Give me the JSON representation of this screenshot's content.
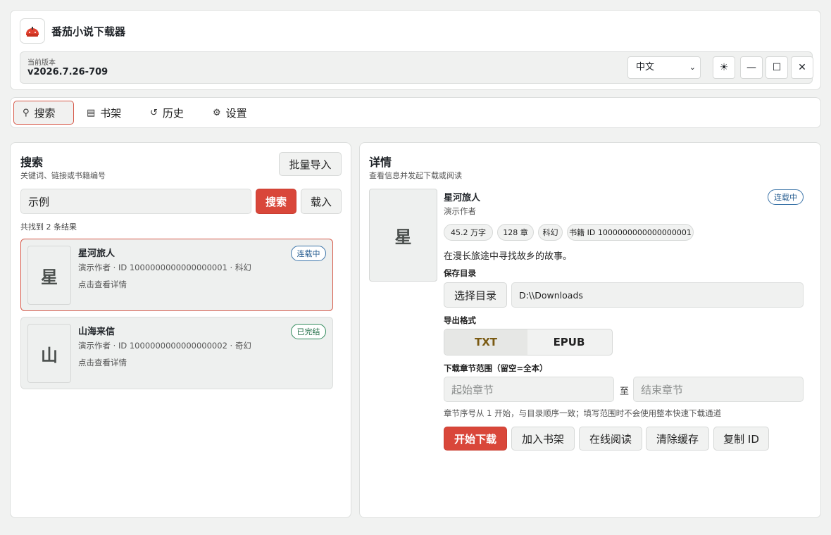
{
  "app": {
    "title": "番茄小说下载器",
    "logo_icon": "tomato-icon"
  },
  "version": {
    "label": "当前版本",
    "value": "v2026.7.26-709"
  },
  "window": {
    "language": "中文",
    "theme_icon": "sun-icon",
    "minimize_icon": "minimize-icon",
    "maximize_icon": "maximize-icon",
    "close_icon": "close-icon"
  },
  "nav": {
    "tabs": [
      {
        "label": "搜索",
        "icon": "search-icon",
        "active": true
      },
      {
        "label": "书架",
        "icon": "bookshelf-icon"
      },
      {
        "label": "历史",
        "icon": "history-icon"
      },
      {
        "label": "设置",
        "icon": "gear-icon"
      }
    ]
  },
  "search": {
    "title": "搜索",
    "subtitle": "关键词、链接或书籍编号",
    "batch_import": "批量导入",
    "query": "示例",
    "search_button": "搜索",
    "load_button": "载入",
    "result_count": "共找到 2 条结果",
    "results": [
      {
        "cover": "星",
        "title": "星河旅人",
        "meta": "演示作者 · ID 1000000000000000001 · 科幻",
        "hint": "点击查看详情",
        "status": "连载中"
      },
      {
        "cover": "山",
        "title": "山海来信",
        "meta": "演示作者 · ID 1000000000000000002 · 奇幻",
        "hint": "点击查看详情",
        "status": "已完结"
      }
    ]
  },
  "detail": {
    "title": "详情",
    "subtitle": "查看信息并发起下载或阅读",
    "cover": "星",
    "book_title": "星河旅人",
    "author": "演示作者",
    "status": "连载中",
    "chips": [
      "45.2 万字",
      "128 章",
      "科幻",
      "书籍 ID 1000000000000000001"
    ],
    "description": "在漫长旅途中寻找故乡的故事。",
    "save_dir_label": "保存目录",
    "choose_dir_button": "选择目录",
    "save_dir_value": "D:\\\\Downloads",
    "format_label": "导出格式",
    "formats": [
      "TXT",
      "EPUB"
    ],
    "range_label": "下载章节范围（留空=全本）",
    "start_placeholder": "起始章节",
    "to_label": "至",
    "end_placeholder": "结束章节",
    "range_hint": "章节序号从 1 开始，与目录顺序一致；填写范围时不会使用整本快速下载通道",
    "actions": [
      "开始下载",
      "加入书架",
      "在线阅读",
      "清除缓存",
      "复制 ID"
    ]
  },
  "colors": {
    "accent": "#d9473a",
    "badge_ongoing": "#3a73a8",
    "badge_done": "#2f8a5a",
    "txt_selected": "#7a5a12"
  }
}
